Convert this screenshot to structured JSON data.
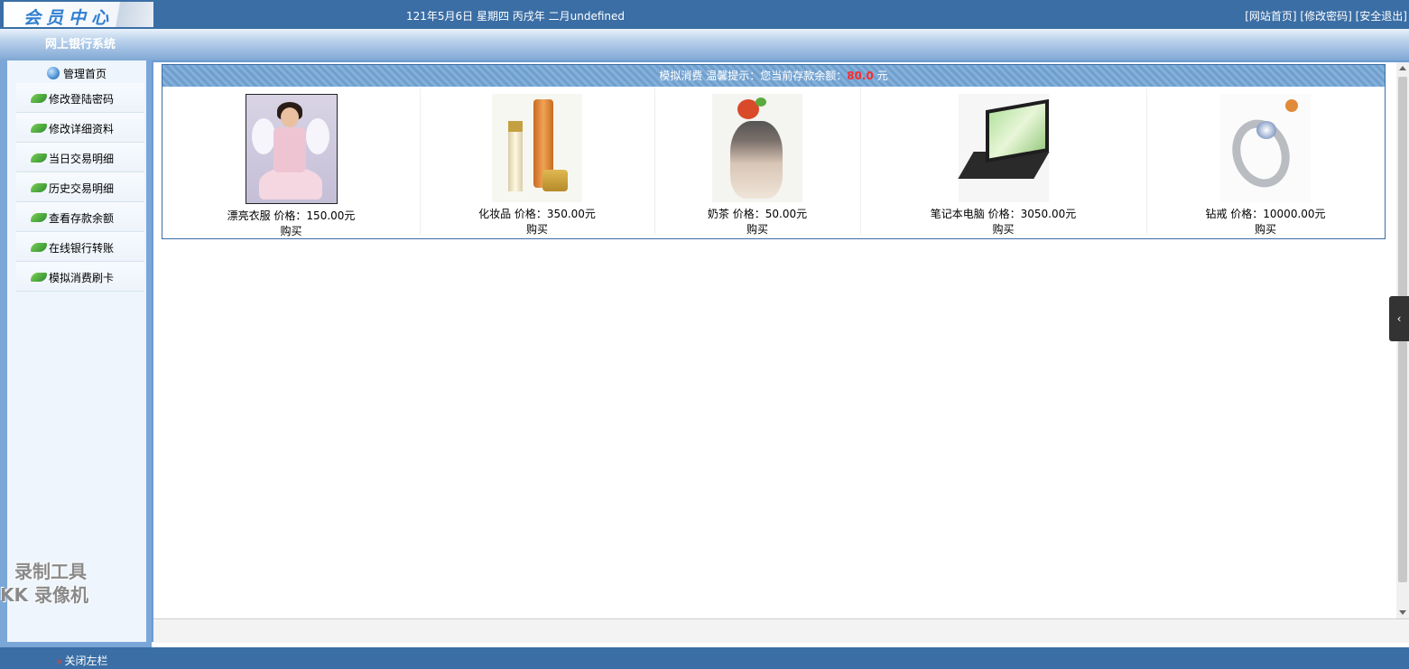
{
  "header": {
    "logo": "会员中心",
    "date": "121年5月6日 星期四 丙戌年 二月undefined",
    "links": [
      "[网站首页]",
      "[修改密码]",
      "[安全退出]"
    ]
  },
  "subheader": {
    "title": "网上银行系统"
  },
  "sidebar": {
    "home": "管理首页",
    "items": [
      {
        "label": "修改登陆密码"
      },
      {
        "label": "修改详细资料"
      },
      {
        "label": "当日交易明细"
      },
      {
        "label": "历史交易明细"
      },
      {
        "label": "查看存款余额"
      },
      {
        "label": "在线银行转账"
      },
      {
        "label": "模拟消费刷卡"
      }
    ]
  },
  "watermark": {
    "line1": "录制工具",
    "line2": "KK 录像机"
  },
  "shop": {
    "title": "模拟消费",
    "tip_prefix": "温馨提示：您当前存款余额：",
    "balance": "80.0",
    "unit": "元",
    "products": [
      {
        "name": "漂亮衣服",
        "price_label": "价格：150.00元",
        "buy": "购买",
        "icon": "dress-photo"
      },
      {
        "name": "化妆品",
        "price_label": "价格：350.00元",
        "buy": "购买",
        "icon": "cosmetics-photo"
      },
      {
        "name": "奶茶",
        "price_label": "价格：50.00元",
        "buy": "购买",
        "icon": "milk-tea-photo"
      },
      {
        "name": "笔记本电脑",
        "price_label": "价格：3050.00元",
        "buy": "购买",
        "icon": "laptop-photo"
      },
      {
        "name": "钻戒",
        "price_label": "价格：10000.00元",
        "buy": "购买",
        "icon": "ring-photo"
      }
    ]
  },
  "footer": {
    "close_left": "关闭左栏"
  },
  "colors": {
    "brand": "#3a6ea5",
    "balance": "#ff2a2a"
  }
}
